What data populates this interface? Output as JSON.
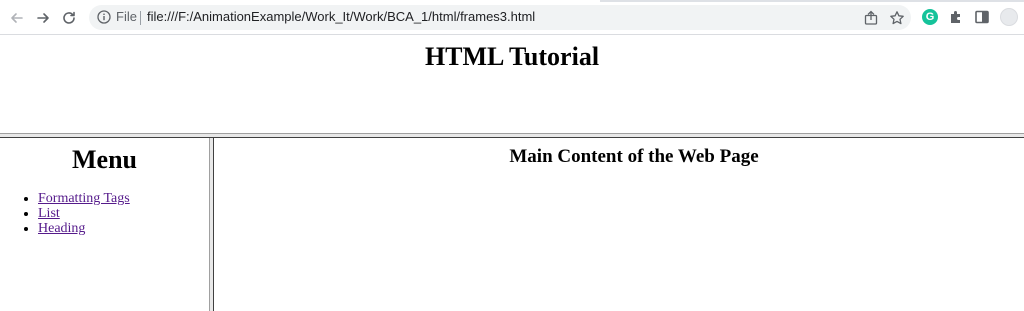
{
  "browser": {
    "url_scheme_label": "File",
    "url": "file:///F:/AnimationExample/Work_It/Work/BCA_1/html/frames3.html",
    "grammarly_letter": "G",
    "icons": [
      "back-arrow-icon",
      "forward-arrow-icon",
      "reload-icon",
      "info-icon",
      "share-icon",
      "star-icon",
      "grammarly-icon",
      "extensions-icon",
      "side-panel-icon",
      "profile-icon"
    ]
  },
  "top_frame": {
    "title": "HTML Tutorial"
  },
  "menu_frame": {
    "title": "Menu",
    "links": [
      {
        "label": "Formatting Tags"
      },
      {
        "label": "List"
      },
      {
        "label": "Heading"
      }
    ],
    "link_color": "#551a8b"
  },
  "main_frame": {
    "heading": "Main Content of the Web Page"
  }
}
